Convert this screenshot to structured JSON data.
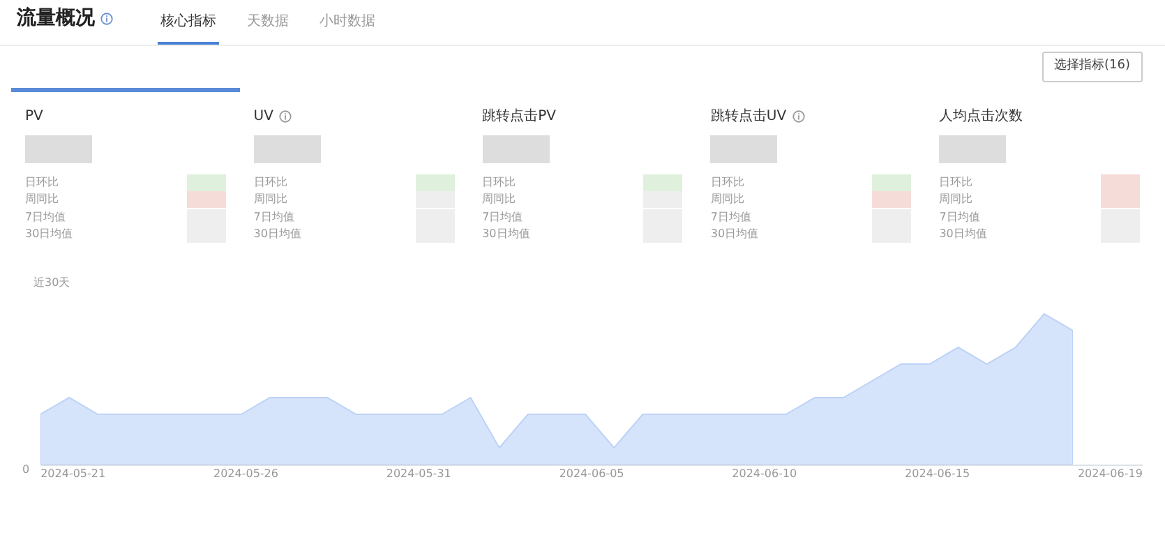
{
  "header": {
    "title": "流量概况",
    "tabs": [
      {
        "label": "核心指标",
        "selected": true
      },
      {
        "label": "天数据",
        "selected": false
      },
      {
        "label": "小时数据",
        "selected": false
      }
    ]
  },
  "select_button": "选择指标(16)",
  "metrics": [
    {
      "label": "PV",
      "info": false,
      "selected": true,
      "rows": [
        {
          "label": "日环比",
          "color": "#dff1dc"
        },
        {
          "label": "周同比",
          "color": "#f6dcd8"
        },
        {
          "label": "7日均值",
          "color": "#eeeeee"
        },
        {
          "label": "30日均值",
          "color": "#eeeeee"
        }
      ]
    },
    {
      "label": "UV",
      "info": true,
      "selected": false,
      "rows": [
        {
          "label": "日环比",
          "color": "#dff1dc"
        },
        {
          "label": "周同比",
          "color": "#eeeeee"
        },
        {
          "label": "7日均值",
          "color": "#eeeeee"
        },
        {
          "label": "30日均值",
          "color": "#eeeeee"
        }
      ]
    },
    {
      "label": "跳转点击PV",
      "info": false,
      "selected": false,
      "rows": [
        {
          "label": "日环比",
          "color": "#dff1dc"
        },
        {
          "label": "周同比",
          "color": "#eeeeee"
        },
        {
          "label": "7日均值",
          "color": "#eeeeee"
        },
        {
          "label": "30日均值",
          "color": "#eeeeee"
        }
      ]
    },
    {
      "label": "跳转点击UV",
      "info": true,
      "selected": false,
      "rows": [
        {
          "label": "日环比",
          "color": "#dff1dc"
        },
        {
          "label": "周同比",
          "color": "#f6dcd8"
        },
        {
          "label": "7日均值",
          "color": "#eeeeee"
        },
        {
          "label": "30日均值",
          "color": "#eeeeee"
        }
      ]
    },
    {
      "label": "人均点击次数",
      "info": false,
      "selected": false,
      "rows": [
        {
          "label": "日环比",
          "color": "#f6dcd8"
        },
        {
          "label": "周同比",
          "color": "#f6dcd8"
        },
        {
          "label": "7日均值",
          "color": "#eeeeee"
        },
        {
          "label": "30日均值",
          "color": "#eeeeee"
        }
      ]
    }
  ],
  "chart": {
    "range_label": "近30天",
    "y_zero": "0",
    "x_labels": [
      "2024-05-21",
      "2024-05-26",
      "2024-05-31",
      "2024-06-05",
      "2024-06-10",
      "2024-06-15",
      "2024-06-19"
    ]
  }
}
